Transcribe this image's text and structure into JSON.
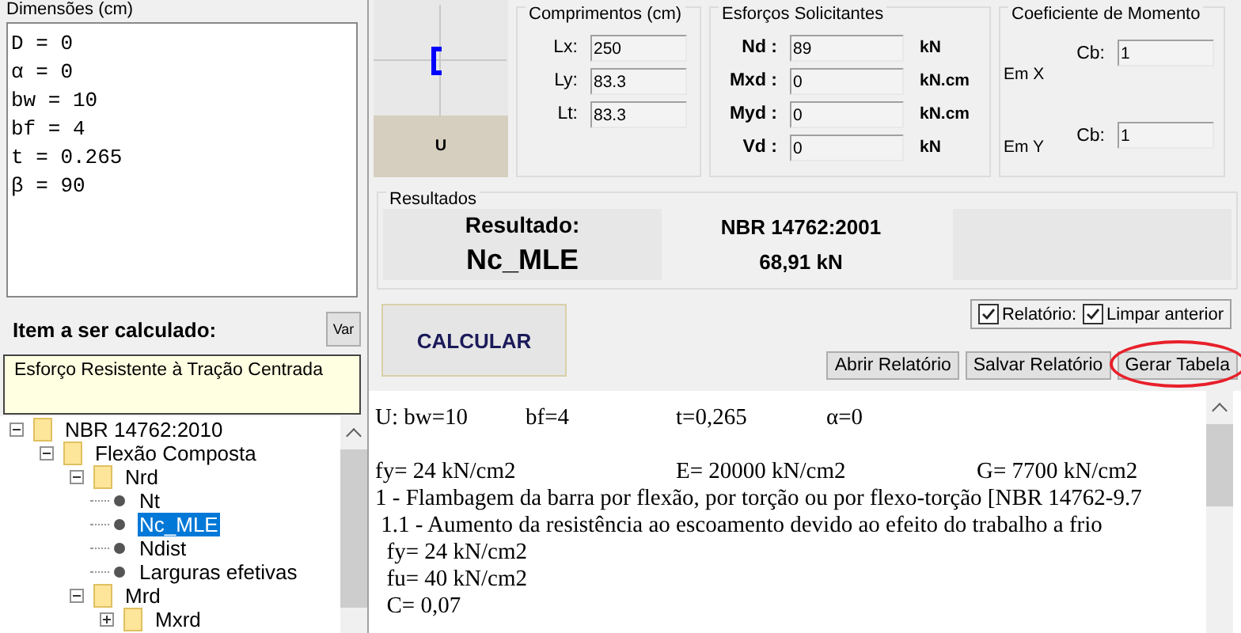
{
  "dimensions": {
    "title": "Dimensões (cm)",
    "lines": [
      "D = 0",
      "α = 0",
      "bw = 10",
      "bf = 4",
      "t = 0.265",
      "β = 90"
    ]
  },
  "item_panel": {
    "title": "Item a ser calculado:",
    "var_button": "Var",
    "description": "Esforço Resistente à Tração Centrada"
  },
  "tree": [
    {
      "label": "NBR 14762:2010",
      "kind": "folder",
      "expanded": true,
      "selected": false,
      "children": [
        {
          "label": "Flexão Composta",
          "kind": "folder",
          "expanded": true,
          "selected": false,
          "children": [
            {
              "label": "Nrd",
              "kind": "folder",
              "expanded": true,
              "selected": false,
              "children": [
                {
                  "label": "Nt",
                  "kind": "leaf",
                  "selected": false
                },
                {
                  "label": "Nc_MLE",
                  "kind": "leaf",
                  "selected": true
                },
                {
                  "label": "Ndist",
                  "kind": "leaf",
                  "selected": false
                },
                {
                  "label": "Larguras efetivas",
                  "kind": "leaf",
                  "selected": false
                }
              ]
            },
            {
              "label": "Mrd",
              "kind": "folder",
              "expanded": true,
              "selected": false,
              "children": [
                {
                  "label": "Mxrd",
                  "kind": "folder",
                  "expanded": false,
                  "selected": false
                }
              ]
            }
          ]
        }
      ]
    }
  ],
  "section": {
    "shape_label": "U"
  },
  "lengths": {
    "title": "Comprimentos (cm)",
    "fields": [
      {
        "label": "Lx:",
        "value": "250"
      },
      {
        "label": "Ly:",
        "value": "83.3"
      },
      {
        "label": "Lt:",
        "value": "83.3"
      }
    ]
  },
  "forces": {
    "title": "Esforços Solicitantes",
    "fields": [
      {
        "label": "Nd :",
        "value": "89",
        "unit": "kN"
      },
      {
        "label": "Mxd :",
        "value": "0",
        "unit": "kN.cm"
      },
      {
        "label": "Myd :",
        "value": "0",
        "unit": "kN.cm"
      },
      {
        "label": "Vd :",
        "value": "0",
        "unit": "kN"
      }
    ]
  },
  "moment_coef": {
    "title": "Coeficiente de Momento",
    "rows": [
      {
        "axis": "Em X",
        "label": "Cb:",
        "value": "1"
      },
      {
        "axis": "Em Y",
        "label": "Cb:",
        "value": "1"
      }
    ]
  },
  "results": {
    "title": "Resultados",
    "heading": "Resultado:",
    "item": "Nc_MLE",
    "standard": "NBR 14762:2001",
    "value": "68,91 kN"
  },
  "options": [
    {
      "label": "Relatório:",
      "checked": true
    },
    {
      "label": "Limpar anterior",
      "checked": true
    }
  ],
  "calculate_button": "CALCULAR",
  "report_buttons": [
    {
      "label": "Abrir Relatório",
      "circled": false
    },
    {
      "label": "Salvar Relatório",
      "circled": false
    },
    {
      "label": "Gerar Tabela",
      "circled": true
    }
  ],
  "report": {
    "lines": [
      {
        "kind": "columns",
        "cells": [
          "U: bw=10",
          "bf=4",
          "t=0,265",
          "α=0"
        ]
      },
      {
        "kind": "blank"
      },
      {
        "kind": "columns",
        "cells": [
          "fy= 24 kN/cm2",
          "E= 20000 kN/cm2",
          "G= 7700 kN/cm2"
        ]
      },
      {
        "kind": "text",
        "text": "1 - Flambagem da barra por flexão, por torção ou por flexo-torção [NBR 14762-9.7"
      },
      {
        "kind": "text",
        "text": " 1.1 - Aumento da resistência ao escoamento devido ao efeito do trabalho a frio"
      },
      {
        "kind": "text",
        "text": "  fy= 24 kN/cm2"
      },
      {
        "kind": "text",
        "text": "  fu= 40 kN/cm2"
      },
      {
        "kind": "text",
        "text": "  C= 0,07"
      }
    ]
  }
}
